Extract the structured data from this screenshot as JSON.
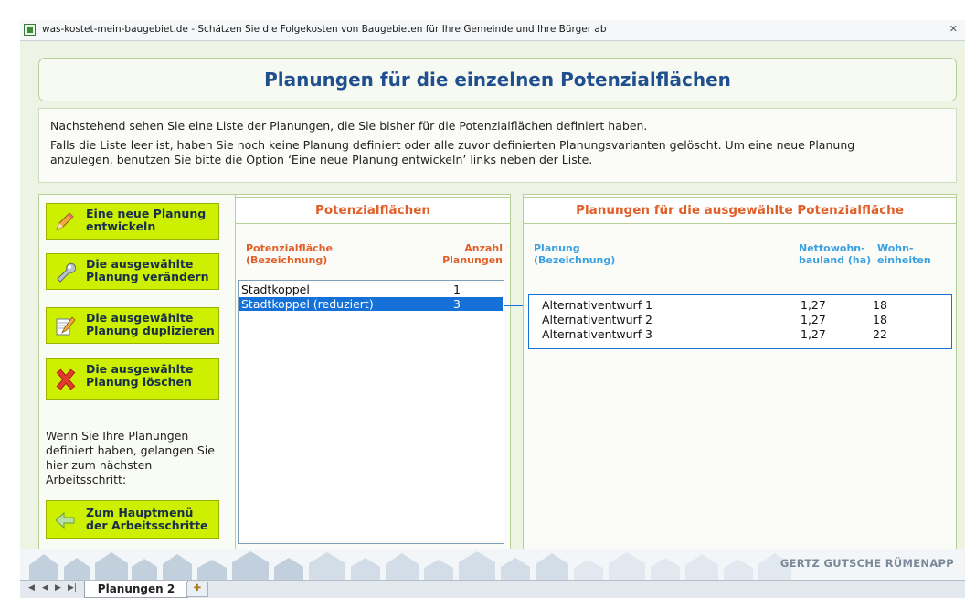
{
  "window": {
    "title": "was-kostet-mein-baugebiet.de - Schätzen Sie die Folgekosten von Baugebieten für Ihre Gemeinde und Ihre Bürger ab",
    "close_glyph": "ꝏ"
  },
  "page_title": "Planungen für die einzelnen Potenzialflächen",
  "intro": {
    "line1": "Nachstehend sehen Sie eine Liste der Planungen, die Sie bisher für die Potenzialflächen definiert haben.",
    "line2": "Falls die Liste leer ist, haben Sie noch keine Planung definiert oder alle zuvor definierten Planungsvarianten gelöscht. Um eine neue Planung",
    "line3": "anzulegen, benutzen Sie bitte die Option ‘Eine neue Planung entwickeln’ links neben der Liste."
  },
  "actions": {
    "new": "Eine neue Planung\nentwickeln",
    "edit": "Die ausgewählte\nPlanung verändern",
    "duplicate": "Die ausgewählte\nPlanung duplizieren",
    "delete": "Die ausgewählte\nPlanung löschen",
    "main_menu": "Zum Hauptmenü\nder Arbeitsschritte"
  },
  "left_note": "Wenn Sie Ihre Planungen definiert haben, gelangen Sie hier zum nächsten Arbeitsschritt:",
  "potenzial": {
    "heading": "Potenzialflächen",
    "col_name": "Potenzialfläche\n(Bezeichnung)",
    "col_count": "Anzahl\nPlanungen",
    "rows": [
      {
        "name": "Stadtkoppel",
        "count": "1",
        "selected": false
      },
      {
        "name": "Stadtkoppel (reduziert)",
        "count": "3",
        "selected": true
      }
    ]
  },
  "planungen": {
    "heading": "Planungen für die ausgewählte Potenzialfläche",
    "col_name": "Planung\n(Bezeichnung)",
    "col_area": "Nettowohn-\nbauland (ha)",
    "col_units": "Wohn-\neinheiten",
    "rows": [
      {
        "name": "Alternativentwurf 1",
        "area": "1,27",
        "units": "18"
      },
      {
        "name": "Alternativentwurf 2",
        "area": "1,27",
        "units": "18"
      },
      {
        "name": "Alternativentwurf 3",
        "area": "1,27",
        "units": "22"
      }
    ]
  },
  "brand": "GERTZ GUTSCHE RÜMENAPP",
  "sheet_tab": "Planungen 2",
  "colors": {
    "accent_green": "#ccf000",
    "title_blue": "#1f4f8f",
    "heading_orange": "#e0602a",
    "column_blue": "#3aa0df",
    "selection": "#1570d8"
  }
}
